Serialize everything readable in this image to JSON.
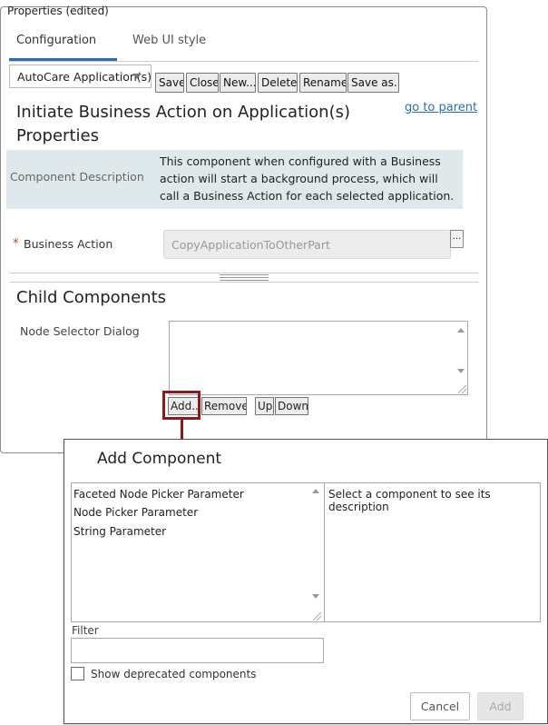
{
  "properties_window": {
    "title": "Properties (edited)",
    "tabs": [
      "Configuration",
      "Web UI style"
    ],
    "selector_value": "AutoCare Application(s)",
    "toolbar": [
      "Save",
      "Close",
      "New...",
      "Delete",
      "Rename",
      "Save as..."
    ],
    "heading_line1": "Initiate Business Action on Application(s)",
    "heading_line2": "Properties",
    "go_to_parent": "go to parent",
    "component_description_label": "Component Description",
    "component_description_text": "This component when configured with a Business action will start a background process, which will call a Business Action for each selected application.",
    "required_marker": "*",
    "business_action_label": "Business Action",
    "business_action_value": "CopyApplicationToOtherPart",
    "browse_button": "...",
    "child_components_heading": "Child Components",
    "node_selector_label": "Node Selector Dialog",
    "child_buttons": {
      "add": "Add...",
      "remove": "Remove",
      "up": "Up",
      "down": "Down"
    }
  },
  "add_component_dialog": {
    "title": "Add Component",
    "components": [
      "Faceted Node Picker Parameter",
      "Node Picker Parameter",
      "String Parameter"
    ],
    "description_placeholder": "Select a component to see its description",
    "filter_label": "Filter",
    "filter_value": "",
    "show_deprecated_label": "Show deprecated components",
    "show_deprecated_checked": false,
    "cancel_label": "Cancel",
    "add_label": "Add"
  },
  "colors": {
    "accent": "#2f6ea8",
    "highlight": "#8b1a1a",
    "description_bg": "#dfe9ec",
    "link": "#2a6fb0"
  }
}
